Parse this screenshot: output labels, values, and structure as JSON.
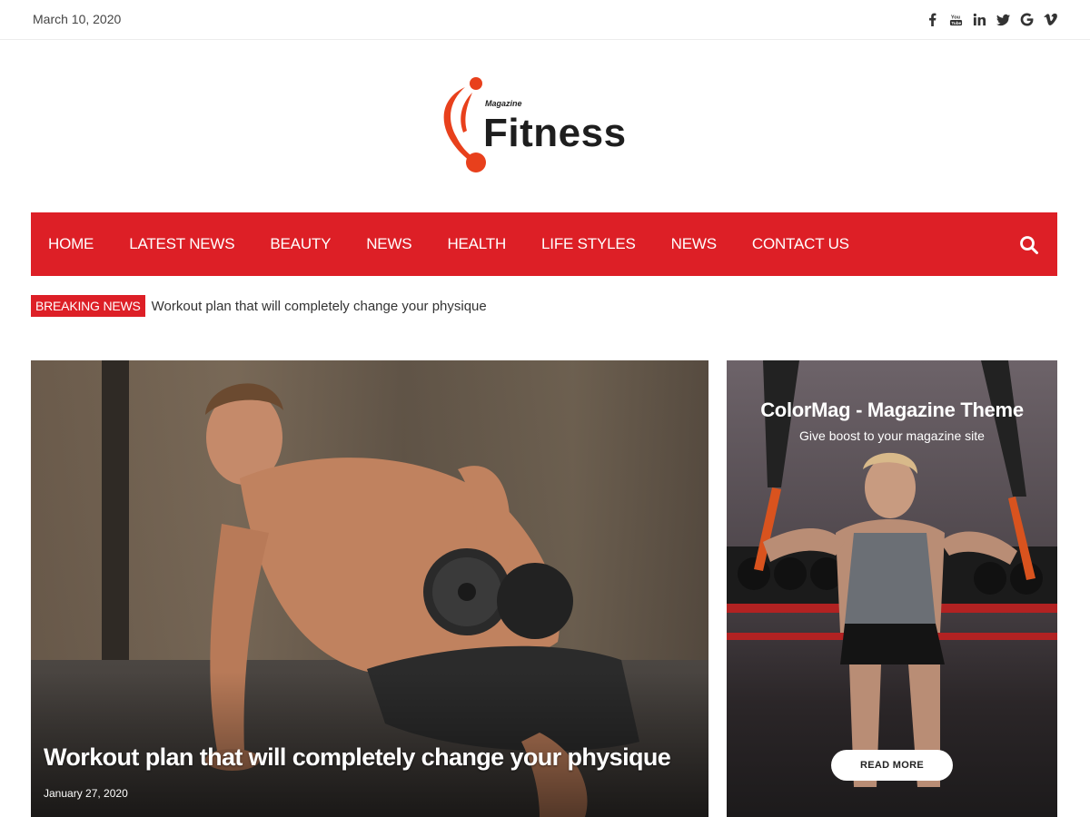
{
  "topbar": {
    "date": "March 10, 2020",
    "social": [
      {
        "icon": "facebook-icon",
        "glyph": "f"
      },
      {
        "icon": "youtube-icon",
        "glyph": "You\nTube"
      },
      {
        "icon": "linkedin-icon",
        "glyph": "in"
      },
      {
        "icon": "twitter-icon",
        "glyph": "twitter"
      },
      {
        "icon": "google-icon",
        "glyph": "G"
      },
      {
        "icon": "vimeo-icon",
        "glyph": "V"
      }
    ]
  },
  "logo": {
    "small_text": "Magazine",
    "name": "Fitness",
    "accent": "#e8401c"
  },
  "nav": {
    "items": [
      "HOME",
      "LATEST NEWS",
      "BEAUTY",
      "NEWS",
      "HEALTH",
      "LIFE STYLES",
      "NEWS",
      "CONTACT US"
    ],
    "background": "#dd1f26",
    "search_icon": "search-icon"
  },
  "breaking": {
    "label": "BREAKING NEWS",
    "headline": "Workout plan that will completely change your physique"
  },
  "featured": {
    "title": "Workout plan that will completely change your physique",
    "date": "January 27, 2020"
  },
  "promo": {
    "title": "ColorMag - Magazine Theme",
    "subtitle": "Give boost to your magazine site",
    "button": "READ MORE"
  }
}
